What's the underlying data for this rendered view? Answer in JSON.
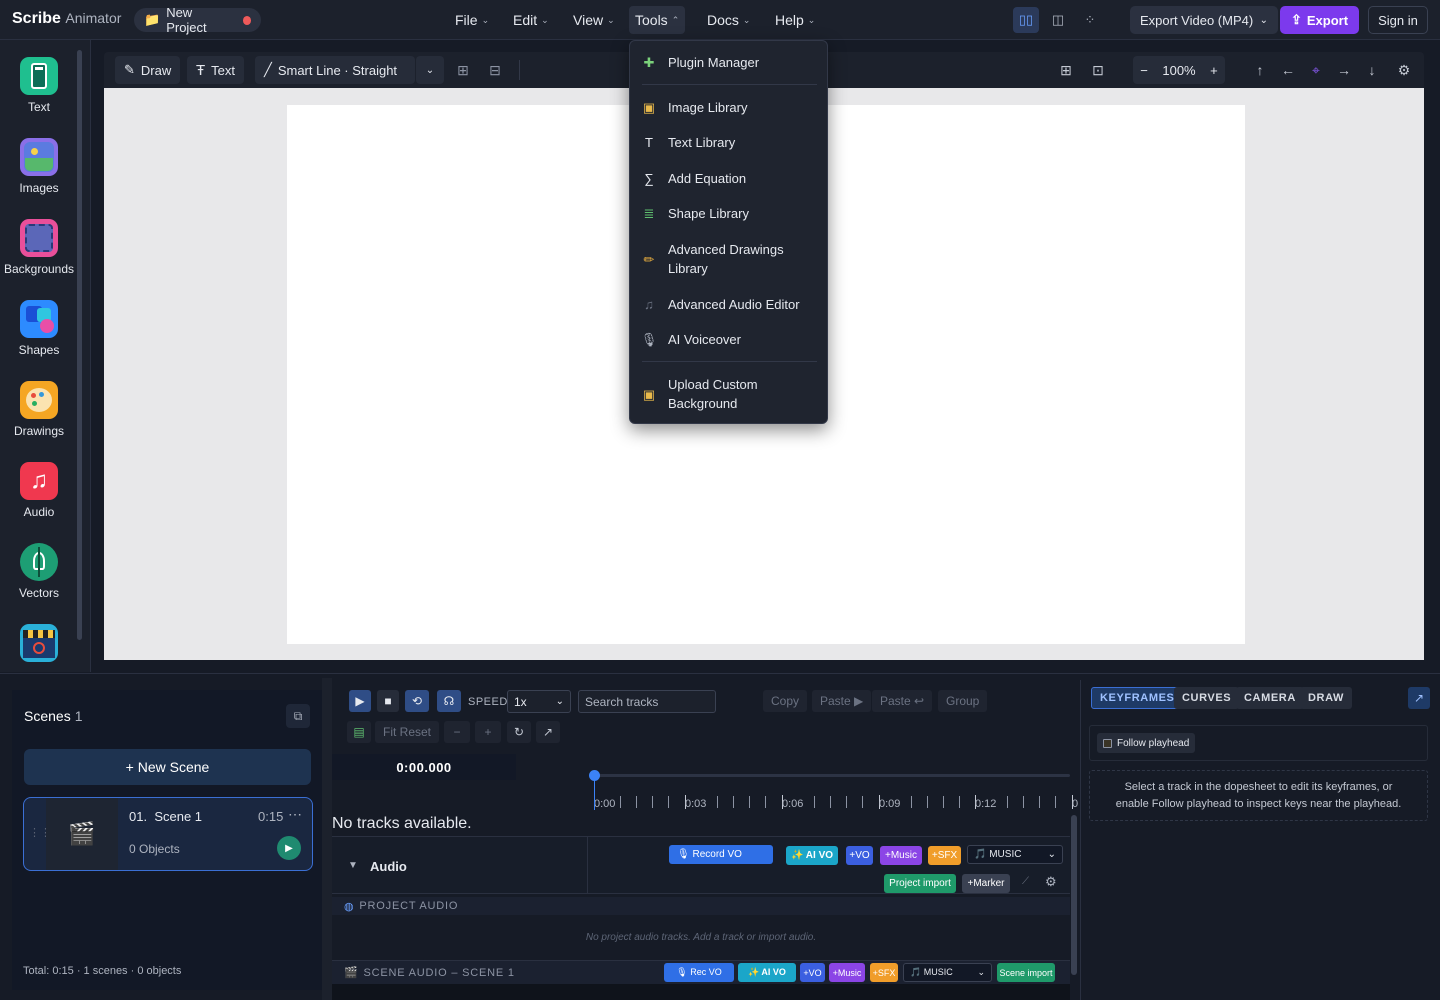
{
  "app": {
    "brand_bold": "Scribe",
    "brand_light": "Animator",
    "project_name": "New Project"
  },
  "menu": {
    "file": "File",
    "edit": "Edit",
    "view": "View",
    "tools": "Tools",
    "docs": "Docs",
    "help": "Help"
  },
  "topbar": {
    "export_format": "Export Video (MP4)",
    "export_label": "Export",
    "signin_label": "Sign in"
  },
  "rail": [
    {
      "label": "Text",
      "icon": "text-icon"
    },
    {
      "label": "Images",
      "icon": "images-icon"
    },
    {
      "label": "Backgrounds",
      "icon": "backgrounds-icon"
    },
    {
      "label": "Shapes",
      "icon": "shapes-icon"
    },
    {
      "label": "Drawings",
      "icon": "drawings-icon"
    },
    {
      "label": "Audio",
      "icon": "audio-icon"
    },
    {
      "label": "Vectors",
      "icon": "vectors-icon"
    },
    {
      "label": "",
      "icon": "video-icon"
    }
  ],
  "toolbar": {
    "draw": "Draw",
    "text": "Text",
    "smart_line": "Smart Line · Straight",
    "zoom": "100%"
  },
  "tools_menu": {
    "plugin_manager": "Plugin Manager",
    "image_library": "Image Library",
    "text_library": "Text Library",
    "add_equation": "Add Equation",
    "shape_library": "Shape Library",
    "advanced_drawings_1": "Advanced Drawings",
    "advanced_drawings_2": "Library",
    "advanced_audio": "Advanced Audio Editor",
    "ai_voiceover": "AI Voiceover",
    "upload_bg_1": "Upload Custom",
    "upload_bg_2": "Background"
  },
  "scenes": {
    "title": "Scenes",
    "count": "1",
    "new_scene": "+ New Scene",
    "scene_number": "01.",
    "scene_name": "Scene 1",
    "scene_duration": "0:15",
    "scene_objects": "0 Objects",
    "footer": "Total: 0:15 · 1 scenes · 0 objects"
  },
  "timeline": {
    "speed_label": "SPEED",
    "speed_value": "1x",
    "search_placeholder": "Search tracks",
    "copy": "Copy",
    "paste": "Paste ▶",
    "paste_in": "Paste ↩",
    "group": "Group",
    "fit_reset": "Fit Reset",
    "time": "0:00.000",
    "ticks": [
      "0:00",
      "0:03",
      "0:06",
      "0:09",
      "0:12",
      "0"
    ],
    "no_tracks": "No tracks available.",
    "audio_label": "Audio",
    "record_vo": "🎙 Record VO",
    "ai_vo": "✨ AI VO",
    "plus_vo": "+VO",
    "plus_music": "+Music",
    "plus_sfx": "+SFX",
    "music": "🎵 MUSIC",
    "project_import": "Project import",
    "marker": "+Marker",
    "project_audio": "PROJECT AUDIO",
    "project_audio_empty": "No project audio tracks. Add a track or import audio.",
    "scene_audio": "SCENE AUDIO – SCENE 1",
    "rec_vo": "🎙 Rec VO",
    "scene_import": "Scene import"
  },
  "inspector": {
    "tabs": [
      "KEYFRAMES",
      "CURVES",
      "CAMERA",
      "DRAW"
    ],
    "follow": "Follow playhead",
    "help_1": "Select a track in the dopesheet to edit its keyframes, or",
    "help_2": "enable Follow playhead to inspect keys near the playhead."
  },
  "colors": {
    "accent": "#7c3aed",
    "playhead": "#3b82f6",
    "active_tab": "#1e3a66"
  }
}
